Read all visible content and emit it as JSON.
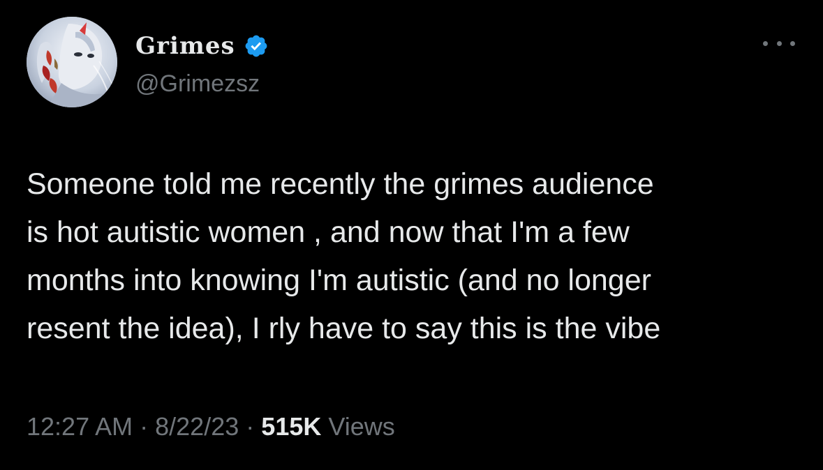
{
  "author": {
    "display_name": "Grimes",
    "handle": "@Grimezsz",
    "verified": true,
    "avatar_icon": "profile-avatar"
  },
  "tweet": {
    "text": "Someone told me recently the grimes audience\nis hot autistic women , and now that I'm a few\nmonths into knowing I'm autistic (and no longer\nresent the idea), I rly have to say this is the vibe"
  },
  "meta": {
    "time": "12:27 AM",
    "separator": "·",
    "date": "8/22/23",
    "views_count": "515K",
    "views_label": "Views"
  },
  "icons": {
    "more": "more-options-icon",
    "verified": "verified-badge-icon"
  },
  "colors": {
    "background": "#000000",
    "text_primary": "#e7e9ea",
    "text_secondary": "#71767b",
    "verified_blue": "#1d9bf0"
  }
}
